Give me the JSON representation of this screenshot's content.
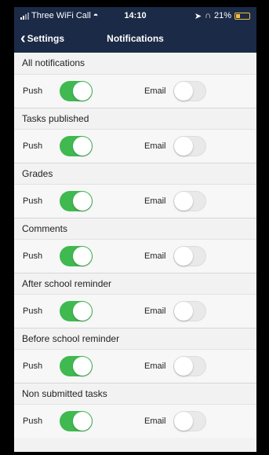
{
  "status_bar": {
    "carrier": "Three WiFi Call",
    "time": "14:10",
    "battery": "21%"
  },
  "nav": {
    "back_label": "Settings",
    "title": "Notifications"
  },
  "labels": {
    "push": "Push",
    "email": "Email"
  },
  "sections": [
    {
      "title": "All notifications",
      "push": true,
      "email": false
    },
    {
      "title": "Tasks published",
      "push": true,
      "email": false
    },
    {
      "title": "Grades",
      "push": true,
      "email": false
    },
    {
      "title": "Comments",
      "push": true,
      "email": false
    },
    {
      "title": "After school reminder",
      "push": true,
      "email": false
    },
    {
      "title": "Before school reminder",
      "push": true,
      "email": false
    },
    {
      "title": "Non submitted tasks",
      "push": true,
      "email": false
    }
  ],
  "colors": {
    "header_bg": "#1b2a46",
    "toggle_on": "#3fb950",
    "toggle_off": "#e9e9ea"
  }
}
